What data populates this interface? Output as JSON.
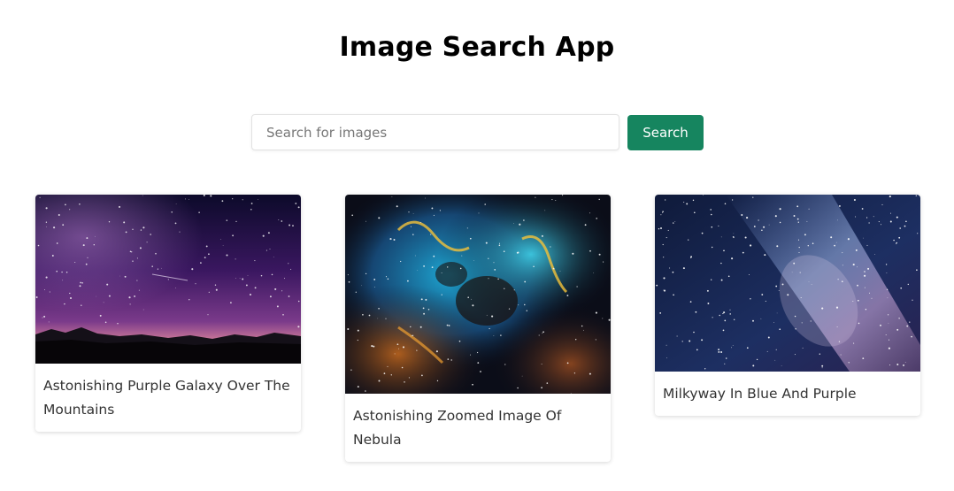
{
  "header": {
    "title": "Image Search App"
  },
  "search": {
    "placeholder": "Search for images",
    "value": "",
    "button_label": "Search"
  },
  "results": [
    {
      "caption": "Astonishing Purple Galaxy Over The Mountains"
    },
    {
      "caption": "Astonishing Zoomed Image Of Nebula"
    },
    {
      "caption": "Milkyway In Blue And Purple"
    }
  ],
  "colors": {
    "accent": "#16855f"
  }
}
